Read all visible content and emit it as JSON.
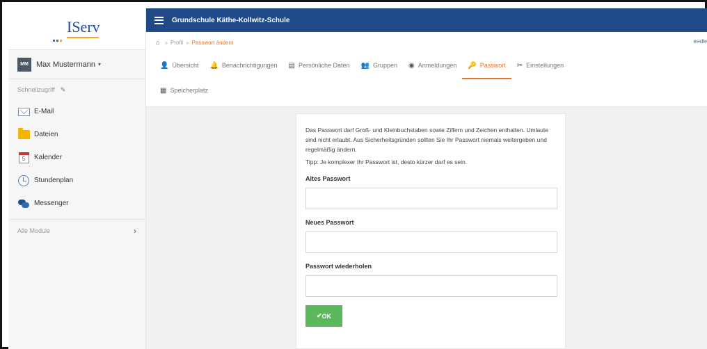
{
  "brand": {
    "logo": "IServ"
  },
  "user": {
    "initials": "MM",
    "name": "Max Mustermann",
    "caret": "▾"
  },
  "sidebar": {
    "shortcuts_label": "Schnellzugriff",
    "items": [
      {
        "label": "E-Mail",
        "icon": "mail-icon"
      },
      {
        "label": "Dateien",
        "icon": "folder-icon"
      },
      {
        "label": "Kalender",
        "icon": "calendar-icon"
      },
      {
        "label": "Stundenplan",
        "icon": "clock-icon"
      },
      {
        "label": "Messenger",
        "icon": "messenger-icon"
      }
    ],
    "all_modules": "Alle Module",
    "calendar_day": "5"
  },
  "header": {
    "school": "Grundschule Käthe-Kollwitz-Schule"
  },
  "breadcrumb": {
    "items": [
      "Profil",
      "Passwort ändern"
    ]
  },
  "help": "Hilfe",
  "tabs": [
    {
      "label": "Übersicht",
      "icon": "person-icon"
    },
    {
      "label": "Benachrichtigungen",
      "icon": "bell-icon"
    },
    {
      "label": "Persönliche Daten",
      "icon": "id-card-icon"
    },
    {
      "label": "Gruppen",
      "icon": "group-icon"
    },
    {
      "label": "Anmeldungen",
      "icon": "eye-icon"
    },
    {
      "label": "Passwort",
      "icon": "key-icon",
      "active": true
    },
    {
      "label": "Einstellungen",
      "icon": "tools-icon"
    },
    {
      "label": "Speicherplatz",
      "icon": "storage-icon"
    }
  ],
  "form": {
    "info": "Das Passwort darf Groß- und Kleinbuchstaben sowie Ziffern und Zeichen enthalten. Umlaute sind nicht erlaubt. Aus Sicherheitsgründen sollten Sie Ihr Passwort niemals weitergeben und regelmäßig ändern.",
    "tip": "Tipp: Je komplexer Ihr Passwort ist, desto kürzer darf es sein.",
    "old_label": "Altes Passwort",
    "new_label": "Neues Passwort",
    "repeat_label": "Passwort wiederholen",
    "old_value": "",
    "new_value": "",
    "repeat_value": "",
    "submit": "OK",
    "submit_icon": "✔"
  },
  "colors": {
    "header": "#1f4a87",
    "accent": "#e8762b",
    "ok": "#5cb85c"
  }
}
